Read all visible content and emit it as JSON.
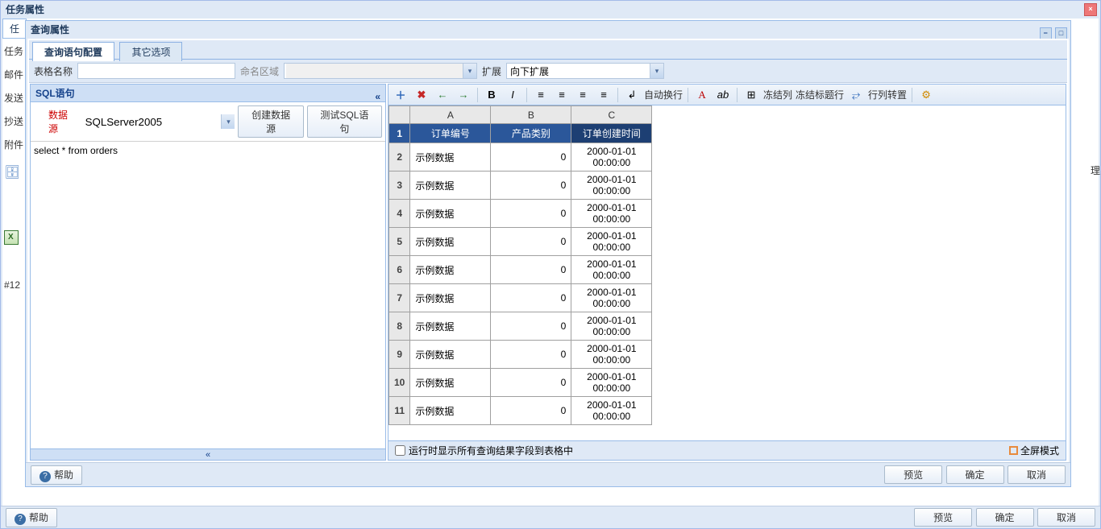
{
  "outer": {
    "title": "任务属性",
    "help": "帮助",
    "preview": "预览",
    "ok": "确定",
    "cancel": "取消"
  },
  "back": {
    "tab": "任",
    "labels": [
      "任务",
      "邮件",
      "发送",
      "抄送",
      "附件"
    ],
    "bottom": "#12"
  },
  "inner": {
    "title": "查询属性"
  },
  "tabs": {
    "a": "查询语句配置",
    "b": "其它选项"
  },
  "form": {
    "tableNameLabel": "表格名称",
    "tableName": "",
    "namedRangeLabel": "命名区域",
    "namedRange": "",
    "expandLabel": "扩展",
    "expand": "向下扩展"
  },
  "sql": {
    "header": "SQL语句",
    "dsLabel": "数据源",
    "dsValue": "SQLServer2005",
    "createDs": "创建数据源",
    "testSql": "测试SQL语句",
    "text": "select * from orders"
  },
  "toolbar": {
    "autoWrap": "自动换行",
    "freezeCol": "冻结列",
    "freezeHeader": "冻结标题行",
    "transpose": "行列转置"
  },
  "grid": {
    "colA": "A",
    "colB": "B",
    "colC": "C",
    "headers": [
      "订单编号",
      "产品类别",
      "订单创建时间"
    ],
    "rows": [
      {
        "n": 2,
        "a": "示例数据",
        "b": "0",
        "c": "2000-01-01 00:00:00"
      },
      {
        "n": 3,
        "a": "示例数据",
        "b": "0",
        "c": "2000-01-01 00:00:00"
      },
      {
        "n": 4,
        "a": "示例数据",
        "b": "0",
        "c": "2000-01-01 00:00:00"
      },
      {
        "n": 5,
        "a": "示例数据",
        "b": "0",
        "c": "2000-01-01 00:00:00"
      },
      {
        "n": 6,
        "a": "示例数据",
        "b": "0",
        "c": "2000-01-01 00:00:00"
      },
      {
        "n": 7,
        "a": "示例数据",
        "b": "0",
        "c": "2000-01-01 00:00:00"
      },
      {
        "n": 8,
        "a": "示例数据",
        "b": "0",
        "c": "2000-01-01 00:00:00"
      },
      {
        "n": 9,
        "a": "示例数据",
        "b": "0",
        "c": "2000-01-01 00:00:00"
      },
      {
        "n": 10,
        "a": "示例数据",
        "b": "0",
        "c": "2000-01-01 00:00:00"
      },
      {
        "n": 11,
        "a": "示例数据",
        "b": "0",
        "c": "2000-01-01 00:00:00"
      }
    ]
  },
  "gridFooter": {
    "showAllFields": "运行时显示所有查询结果字段到表格中",
    "fullscreen": "全屏模式"
  },
  "innerButtons": {
    "help": "帮助",
    "preview": "预览",
    "ok": "确定",
    "cancel": "取消"
  },
  "sideIcon": "理"
}
